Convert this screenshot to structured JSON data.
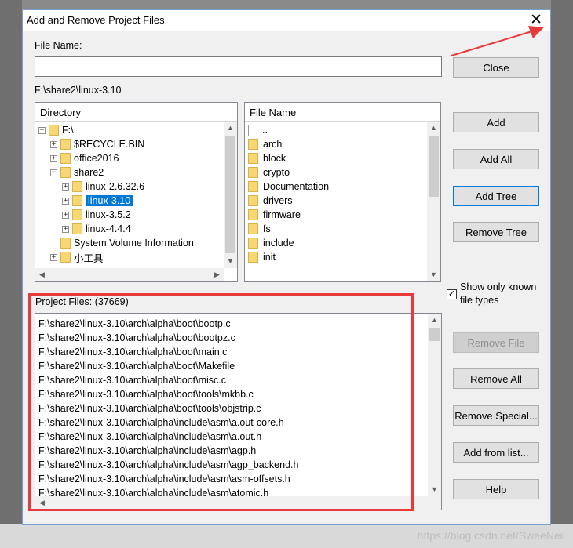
{
  "window": {
    "title": "Add and Remove Project Files"
  },
  "file_name": {
    "label": "File Name:",
    "value": ""
  },
  "current_path": "F:\\share2\\linux-3.10",
  "directory": {
    "header": "Directory",
    "items": [
      {
        "label": "F:\\",
        "expander": "−"
      },
      {
        "label": "$RECYCLE.BIN",
        "expander": "+"
      },
      {
        "label": "office2016",
        "expander": "+"
      },
      {
        "label": "share2",
        "expander": "−"
      },
      {
        "label": "linux-2.6.32.6",
        "expander": "+"
      },
      {
        "label": "linux-3.10",
        "expander": "+"
      },
      {
        "label": "linux-3.5.2",
        "expander": "+"
      },
      {
        "label": "linux-4.4.4",
        "expander": "+"
      },
      {
        "label": "System Volume Information",
        "expander": ""
      },
      {
        "label": "小工具",
        "expander": "+"
      }
    ]
  },
  "files": {
    "header": "File Name",
    "items": [
      "..",
      "arch",
      "block",
      "crypto",
      "Documentation",
      "drivers",
      "firmware",
      "fs",
      "include",
      "init"
    ]
  },
  "buttons": {
    "close": "Close",
    "add": "Add",
    "add_all": "Add All",
    "add_tree": "Add Tree",
    "remove_tree": "Remove Tree",
    "remove_file": "Remove File",
    "remove_all": "Remove All",
    "remove_special": "Remove Special...",
    "add_from_list": "Add from list...",
    "help": "Help"
  },
  "show_known": {
    "label_line1": "Show only known",
    "label_line2": "file types",
    "checked": true,
    "mark": "✓"
  },
  "project_files": {
    "label": "Project Files: (37669)",
    "items": [
      "F:\\share2\\linux-3.10\\arch\\alpha\\boot\\bootp.c",
      "F:\\share2\\linux-3.10\\arch\\alpha\\boot\\bootpz.c",
      "F:\\share2\\linux-3.10\\arch\\alpha\\boot\\main.c",
      "F:\\share2\\linux-3.10\\arch\\alpha\\boot\\Makefile",
      "F:\\share2\\linux-3.10\\arch\\alpha\\boot\\misc.c",
      "F:\\share2\\linux-3.10\\arch\\alpha\\boot\\tools\\mkbb.c",
      "F:\\share2\\linux-3.10\\arch\\alpha\\boot\\tools\\objstrip.c",
      "F:\\share2\\linux-3.10\\arch\\alpha\\include\\asm\\a.out-core.h",
      "F:\\share2\\linux-3.10\\arch\\alpha\\include\\asm\\a.out.h",
      "F:\\share2\\linux-3.10\\arch\\alpha\\include\\asm\\agp.h",
      "F:\\share2\\linux-3.10\\arch\\alpha\\include\\asm\\agp_backend.h",
      "F:\\share2\\linux-3.10\\arch\\alpha\\include\\asm\\asm-offsets.h",
      "F:\\share2\\linux-3.10\\arch\\alpha\\include\\asm\\atomic.h"
    ]
  },
  "watermark": "https://blog.csdn.net/SweeNeil",
  "glyphs": {
    "close": "✕",
    "up": "▲",
    "down": "▼",
    "left": "◀",
    "right": "▶"
  }
}
